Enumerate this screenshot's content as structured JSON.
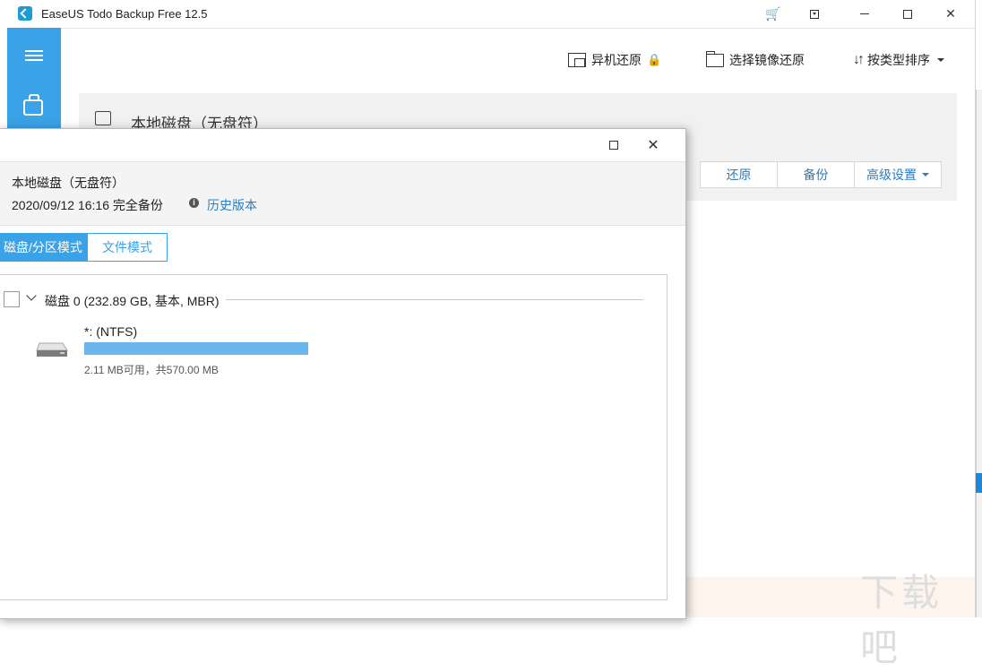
{
  "app": {
    "title": "EaseUS Todo Backup Free 12.5"
  },
  "titlebar_icons": {
    "cart": "cart-icon",
    "dropdown": "dropdown-icon",
    "minimize": "minimize-icon",
    "maximize": "maximize-icon",
    "close": "close-icon"
  },
  "toolbar": {
    "offsite_restore": "异机还原",
    "browse_image_restore": "选择镜像还原",
    "sort_by_type": "按类型排序"
  },
  "card": {
    "title": "本地磁盘（无盘符）",
    "actions": {
      "restore": "还原",
      "backup": "备份",
      "advanced": "高级设置"
    }
  },
  "dialog": {
    "disk_name": "本地磁盘（无盘符）",
    "backup_info": "2020/09/12 16:16 完全备份",
    "history_link": "历史版本",
    "info_icon": "i",
    "tabs": {
      "disk_partition": "磁盘/分区模式",
      "file": "文件模式"
    },
    "disk": {
      "label": "磁盘 0 (232.89 GB, 基本, MBR)"
    },
    "partition": {
      "name": "*: (NTFS)",
      "used_fraction": 1.0,
      "capacity": "2.11 MB可用，共570.00 MB"
    },
    "close_glyph": "✕"
  },
  "watermark": "下载吧",
  "colors": {
    "accent": "#3aa2e6",
    "link": "#2a7dc0",
    "lock": "#f0a100"
  }
}
